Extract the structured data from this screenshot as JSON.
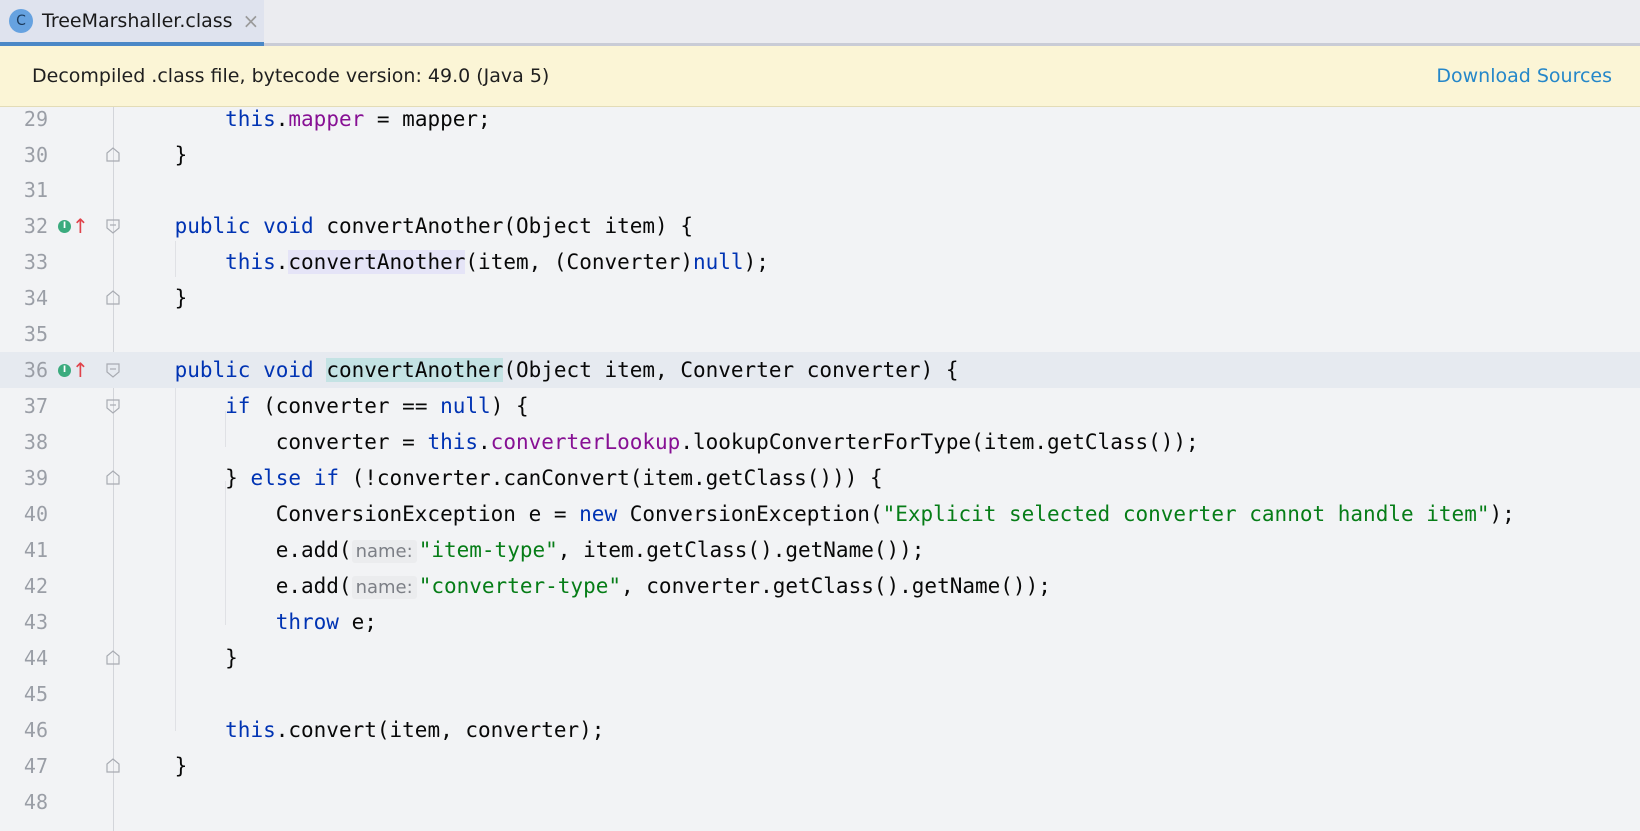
{
  "tab": {
    "icon_letter": "C",
    "label": "TreeMarshaller.class",
    "close_glyph": "×"
  },
  "banner": {
    "message": "Decompiled .class file, bytecode version: 49.0 (Java 5)",
    "action": "Download Sources"
  },
  "markers": {
    "implements_letter": "I",
    "arrow_glyph": "↑"
  },
  "hints": {
    "name": "name:"
  },
  "code": {
    "ln29": "29",
    "ln30": "30",
    "ln31": "31",
    "ln32": "32",
    "ln33": "33",
    "ln34": "34",
    "ln35": "35",
    "ln36": "36",
    "ln37": "37",
    "ln38": "38",
    "ln39": "39",
    "ln40": "40",
    "ln41": "41",
    "ln42": "42",
    "ln43": "43",
    "ln44": "44",
    "ln45": "45",
    "ln46": "46",
    "ln47": "47",
    "ln48": "48",
    "t_this": "this",
    "t_mapper": "mapper",
    "t_assign_mapper": " = mapper;",
    "t_dot": ".",
    "t_close_brace": "}",
    "t_public": "public",
    "t_void": "void",
    "t_convertAnother": "convertAnother",
    "t_sig1": "(Object item) {",
    "t_call1_args": "(item, (Converter)",
    "t_null": "null",
    "t_call1_end": ");",
    "t_sig2": "(Object item, Converter converter) {",
    "t_if": "if",
    "t_if_cond": " (converter == ",
    "t_if_end": ") {",
    "t_conv_assign": "converter = ",
    "t_converterLookup": "converterLookup",
    "t_lookup_call": ".lookupConverterForType(item.getClass());",
    "t_else_open": "} ",
    "t_else": "else",
    "t_else_cond": " (!converter.canConvert(item.getClass())) {",
    "t_exc_decl": "ConversionException e = ",
    "t_new": "new",
    "t_exc_ctor": " ConversionException(",
    "t_exc_msg": "\"Explicit selected converter cannot handle item\"",
    "t_exc_end": ");",
    "t_eadd": "e.add(",
    "t_item_type": "\"item-type\"",
    "t_item_rest": ", item.getClass().getName());",
    "t_converter_type": "\"converter-type\"",
    "t_converter_rest": ", converter.getClass().getName());",
    "t_throw": "throw",
    "t_throw_rest": " e;",
    "t_convert_call": ".convert(item, converter);"
  }
}
